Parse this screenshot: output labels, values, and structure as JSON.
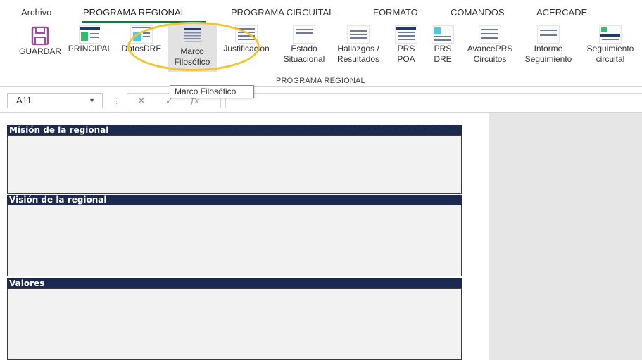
{
  "menu": {
    "tabs": [
      {
        "label": "Archivo"
      },
      {
        "label": "PROGRAMA REGIONAL"
      },
      {
        "label": "PROGRAMA CIRCUITAL"
      },
      {
        "label": "FORMATO"
      },
      {
        "label": "COMANDOS"
      },
      {
        "label": "ACERCADE"
      }
    ],
    "active_tab": "PROGRAMA REGIONAL"
  },
  "ribbon": {
    "group_label": "PROGRAMA REGIONAL",
    "buttons": [
      {
        "label1": "GUARDAR",
        "label2": "",
        "icon": "save-icon"
      },
      {
        "label1": "PRINCIPAL",
        "label2": "",
        "icon": "sheet-thumbnail-icon"
      },
      {
        "label1": "DatosDRE",
        "label2": "",
        "icon": "sheet-thumbnail-icon"
      },
      {
        "label1": "Marco",
        "label2": "Filosófico",
        "icon": "document-lines-icon",
        "pressed": true
      },
      {
        "label1": "Justificación",
        "label2": "",
        "icon": "sheet-thumbnail-icon"
      },
      {
        "label1": "Estado",
        "label2": "Situacional",
        "icon": "sheet-thumbnail-icon"
      },
      {
        "label1": "Hallazgos /",
        "label2": "Resultados",
        "icon": "sheet-thumbnail-icon"
      },
      {
        "label1": "PRS",
        "label2": "POA",
        "icon": "sheet-thumbnail-icon"
      },
      {
        "label1": "PRS",
        "label2": "DRE",
        "icon": "sheet-thumbnail-icon"
      },
      {
        "label1": "AvancePRS",
        "label2": "Circuitos",
        "icon": "sheet-thumbnail-icon"
      },
      {
        "label1": "Informe",
        "label2": "Seguimiento",
        "icon": "sheet-thumbnail-icon"
      },
      {
        "label1": "Seguimiento",
        "label2": "circuital",
        "icon": "sheet-thumbnail-icon"
      }
    ]
  },
  "tooltip": {
    "text": "Marco Filosófico"
  },
  "formula_bar": {
    "name_box": "A11",
    "cancel_glyph": "✕",
    "enter_glyph": "✓",
    "fx_glyph": "fx",
    "value": ""
  },
  "sheet": {
    "sections": [
      {
        "title": "Misión de la regional"
      },
      {
        "title": "Visión de la regional"
      },
      {
        "title": "Valores"
      }
    ]
  },
  "colors": {
    "accent": "#217346",
    "section_header_bg": "#1b2a4e",
    "highlight": "#f4c52b",
    "pressed_bg": "#e2e2e2"
  }
}
